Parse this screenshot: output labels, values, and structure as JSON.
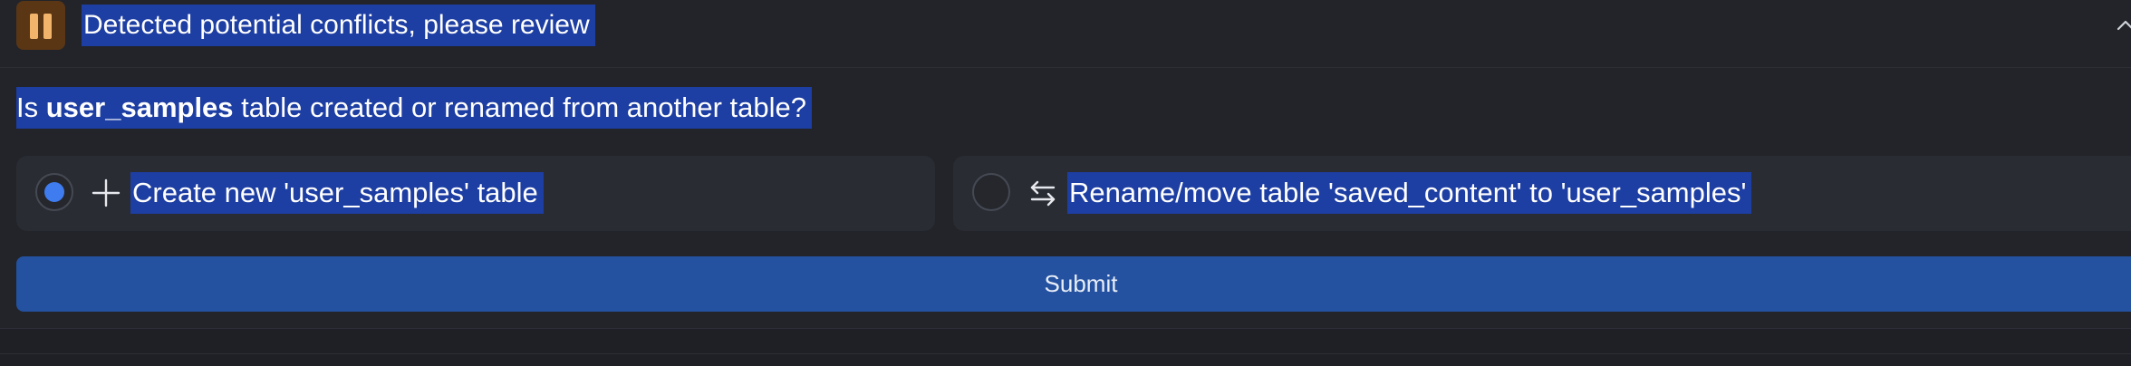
{
  "header": {
    "icon": "pause-icon",
    "title": "Detected potential conflicts, please review",
    "collapse_icon": "chevron-up-icon"
  },
  "question": {
    "prefix": "Is ",
    "table_name": "user_samples",
    "suffix": " table created or renamed from another table?"
  },
  "options": [
    {
      "icon": "plus-icon",
      "label": "Create new 'user_samples' table",
      "selected": true
    },
    {
      "icon": "swap-arrows-icon",
      "label": "Rename/move table 'saved_content' to 'user_samples'",
      "selected": false
    }
  ],
  "submit": {
    "label": "Submit"
  },
  "colors": {
    "accent": "#3f7cf0",
    "submit_bg": "#2452a0",
    "selection_highlight": "#1d3ea2",
    "pause_icon_bg": "#5a3615",
    "pause_icon_fg": "#f2b46a"
  }
}
